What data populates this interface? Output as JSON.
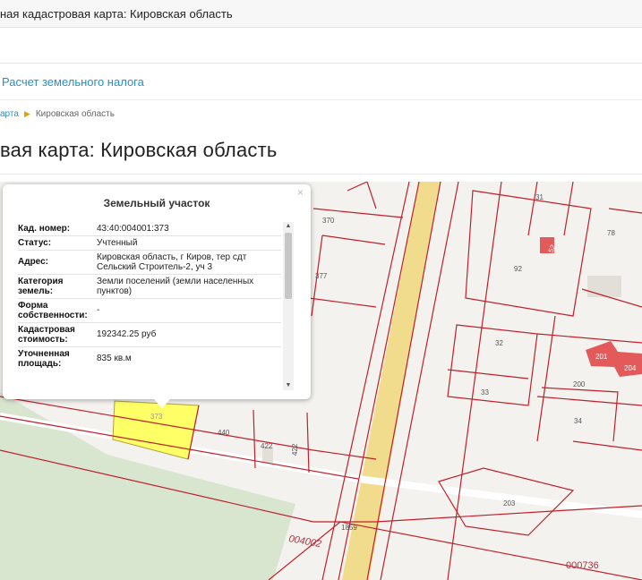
{
  "header": {
    "title": "ная кадастровая карта: Кировская область"
  },
  "nav": {
    "tab_label": "Расчет земельного налога"
  },
  "breadcrumb": {
    "link": "арта",
    "current": "Кировская область"
  },
  "page": {
    "title": "вая карта: Кировская область"
  },
  "popup": {
    "close": "×",
    "title": "Земельный участок",
    "rows": [
      {
        "key": "Кад. номер:",
        "value": "43:40:004001:373"
      },
      {
        "key": "Статус:",
        "value": "Учтенный"
      },
      {
        "key": "Адрес:",
        "value": "Кировская область, г Киров, тер сдт Сельский Строитель-2, уч 3"
      },
      {
        "key": "Категория земель:",
        "value": "Земли поселений (земли населенных пунктов)"
      },
      {
        "key": "Форма собственности:",
        "value": "-"
      },
      {
        "key": "Кадастровая стоимость:",
        "value": "192342.25 руб"
      },
      {
        "key": "Уточненная площадь:",
        "value": "835 кв.м"
      }
    ]
  },
  "map_labels": {
    "l370": "370",
    "l377": "377",
    "l31": "31",
    "l52": "52",
    "l92": "92",
    "l78": "78",
    "l32": "32",
    "l201": "201",
    "l204": "204",
    "l33": "33",
    "l200": "200",
    "l34": "34",
    "l440": "440",
    "l422a": "422",
    "l422b": "422",
    "l373": "373",
    "l203": "203",
    "l1859": "1859",
    "l004002": "004002",
    "l000736": "000736"
  },
  "colors": {
    "boundary": "#c0202c",
    "selected_parcel": "#ffff66",
    "road": "#f0dc8c",
    "forest": "#d9e6cf",
    "building": "#e35a5a"
  }
}
